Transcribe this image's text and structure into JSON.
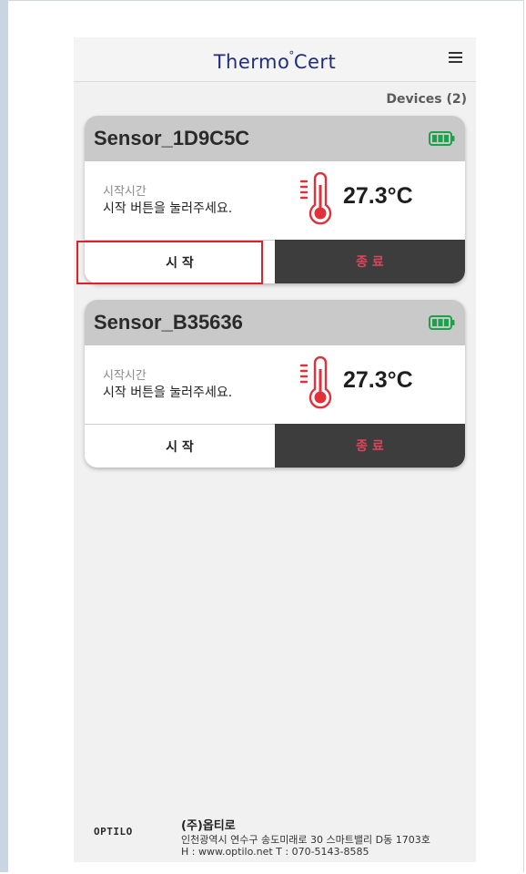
{
  "app": {
    "logo_left": "Thermo",
    "logo_degree": "°",
    "logo_right": "Cert",
    "menu_icon": "hamburger-menu-icon"
  },
  "devices_label": "Devices (2)",
  "devices": [
    {
      "name": "Sensor_1D9C5C",
      "battery_icon": "battery-full-icon",
      "start_caption": "시작시간",
      "start_message": "시작 버튼을 눌러주세요.",
      "temperature": "27.3°C",
      "start_button": "시 작",
      "stop_button": "종 료"
    },
    {
      "name": "Sensor_B35636",
      "battery_icon": "battery-full-icon",
      "start_caption": "시작시간",
      "start_message": "시작 버튼을 눌러주세요.",
      "temperature": "27.3°C",
      "start_button": "시 작",
      "stop_button": "종 료"
    }
  ],
  "footer": {
    "logo": "OPTILO",
    "company": "(주)옵티로",
    "address": "인천광역시 연수구 송도미래로 30 스마트밸리 D동 1703호",
    "contact": "H : www.optilo.net  T : 070-5143-8585"
  },
  "colors": {
    "logo": "#1f2d7b",
    "battery": "#1aa34a",
    "thermometer": "#e0303a",
    "stop_button_bg": "#3d3d3d",
    "stop_button_text": "#e0445a",
    "highlight": "#e0202a"
  }
}
